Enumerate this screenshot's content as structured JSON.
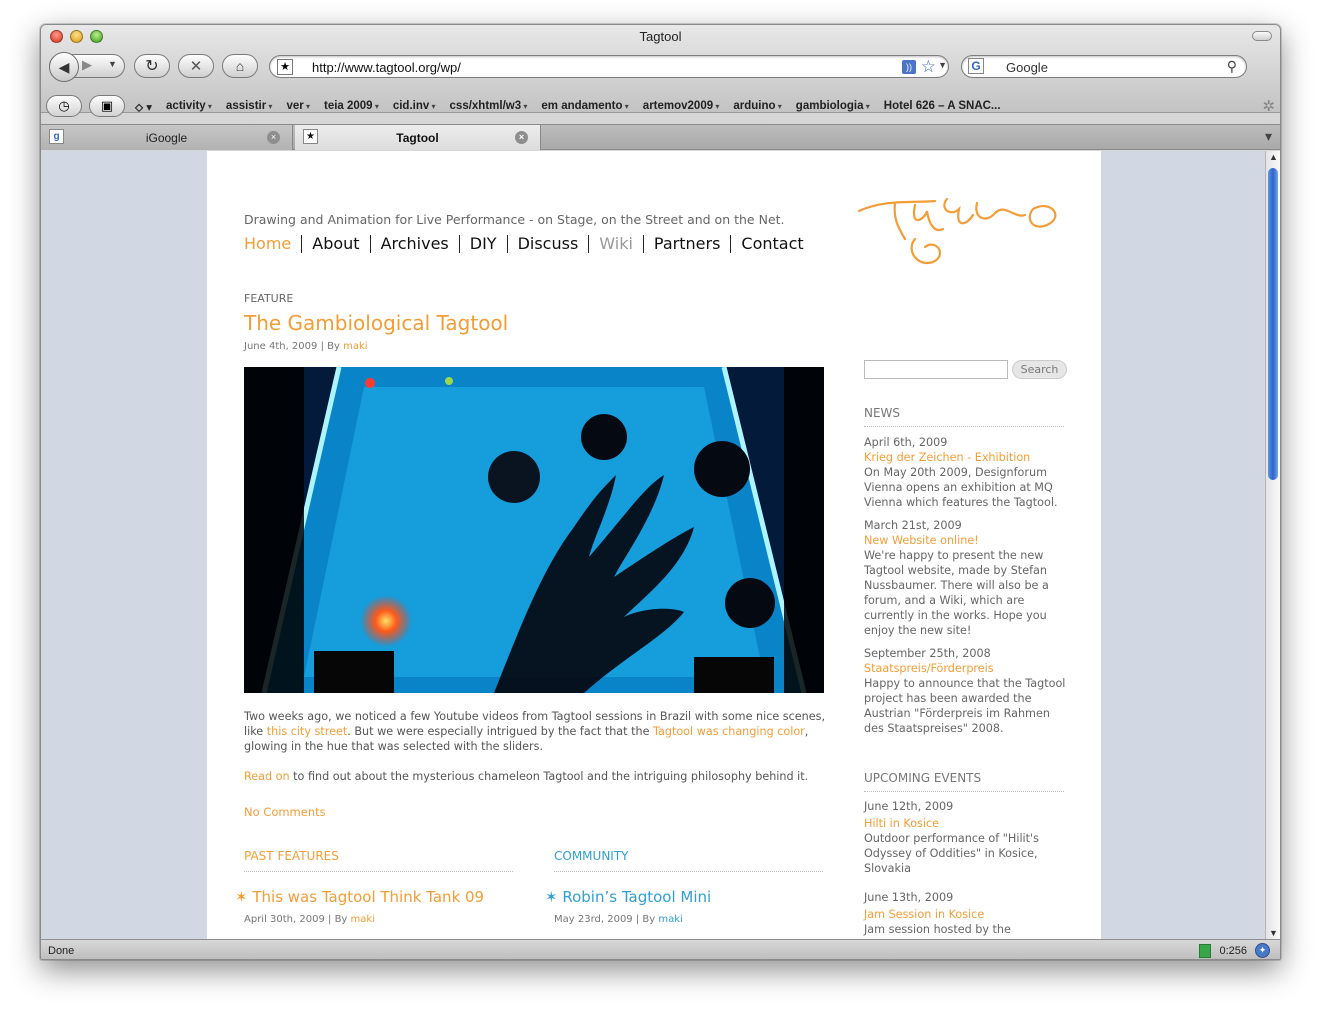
{
  "window": {
    "title": "Tagtool",
    "address": "http://www.tagtool.org/wp/",
    "search_value": "Google",
    "bookmarks": [
      "activity",
      "assistir",
      "ver",
      "teia 2009",
      "cid.inv",
      "css/xhtml/w3",
      "em andamento",
      "artemov2009",
      "arduino",
      "gambiologia",
      "Hotel 626 – A SNAC..."
    ],
    "tabs": [
      {
        "label": "iGoogle"
      },
      {
        "label": "Tagtool"
      }
    ],
    "status": "Done",
    "status_time": "0:256"
  },
  "page": {
    "tagline": "Drawing and Animation for Live Performance - on Stage, on the Street and on the Net.",
    "nav": [
      "Home",
      "About",
      "Archives",
      "DIY",
      "Discuss",
      "Wiki",
      "Partners",
      "Contact"
    ],
    "feature_label": "FEATURE",
    "post": {
      "title": "The Gambiological Tagtool",
      "date": "June 4th, 2009",
      "by": "| By",
      "author": "maki",
      "body1_a": "Two weeks ago, we noticed a few Youtube videos from Tagtool sessions in Brazil with some nice scenes, like ",
      "body1_link1": "this city street",
      "body1_b": ". But we were especially intrigued by the fact that the ",
      "body1_link2": "Tagtool was changing color",
      "body1_c": ", glowing in the hue that was selected with the sliders.",
      "read_on": "Read on",
      "body2": " to find out about the mysterious chameleon Tagtool and the intriguing philosophy behind it.",
      "comments": "No Comments"
    },
    "past_features": {
      "heading": "PAST FEATURES",
      "title": "This was Tagtool Think Tank 09",
      "date": "April 30th, 2009",
      "by": "| By",
      "author": "maki"
    },
    "community": {
      "heading": "COMMUNITY",
      "title": "Robin’s Tagtool Mini",
      "date": "May 23rd, 2009",
      "by": "| By",
      "author": "maki"
    },
    "sidebar": {
      "search_button": "Search",
      "news_heading": "NEWS",
      "news": [
        {
          "date": "April 6th, 2009",
          "title": "Krieg der Zeichen - Exhibition",
          "text": "On May 20th 2009, Designforum Vienna opens an exhibition at MQ Vienna which features the Tagtool."
        },
        {
          "date": "March 21st, 2009",
          "title": "New Website online!",
          "text": "We're happy to present the new Tagtool website, made by Stefan Nussbaumer. There will also be a forum, and a Wiki, which are currently in the works. Hope you enjoy the new site!"
        },
        {
          "date": "September 25th, 2008",
          "title": "Staatspreis/Förderpreis",
          "text": "Happy to announce that the Tagtool project has been awarded the Austrian \"Förderpreis im Rahmen des Staatspreises\" 2008."
        }
      ],
      "events_heading": "UPCOMING EVENTS",
      "events": [
        {
          "date": "June 12th, 2009",
          "title": "Hilti in Kosice",
          "text": "Outdoor performance of \"Hilit's Odyssey of Oddities\" in Kosice, Slovakia"
        },
        {
          "date": "June 13th, 2009",
          "title": "Jam Session in Kosice",
          "text": "Jam session hosted by the ensemble"
        }
      ]
    }
  }
}
